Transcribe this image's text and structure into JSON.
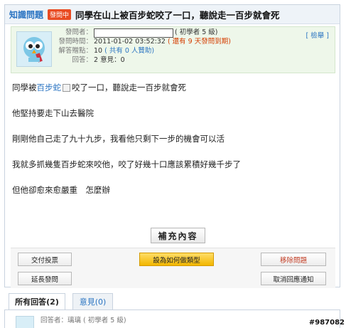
{
  "header": {
    "tagline": "知識問題",
    "status": "發問中",
    "title": "同學在山上被百步蛇咬了一口，聽說走一百步就會死"
  },
  "info": {
    "asker_label": "發問者：",
    "asker_level": "( 初學者 5 級)",
    "time_label": "發問時間：",
    "time_value": "2011-01-02 03:52:32",
    "time_remain": "( 還有 9 天發問到期)",
    "points_label": "解答贈點：",
    "points_value": "10",
    "points_extra": "( 共有 0 人贊助)",
    "answers_label": "回答：",
    "answers_value": "2 意見：0",
    "report": "[ 檢舉 ]"
  },
  "body": {
    "p1_pre": "同學被",
    "p1_link": "百步蛇",
    "p1_post": "咬了一口，聽說走一百步就會死",
    "p2": "他堅持要走下山去醫院",
    "p3": "剛剛他自己走了九十九步，我看他只剩下一步的機會可以活",
    "p4": "我就多抓幾隻百步蛇來咬他，咬了好幾十口應該累積好幾千步了",
    "p5": "但他卻愈來愈嚴重　怎麼辦"
  },
  "supplement": "補充內容",
  "actions": {
    "vote": "交付投票",
    "set_type": "設為如何做類型",
    "remove": "移除問題",
    "extend": "延長發問",
    "cancel_notify": "取消回應通知"
  },
  "tabs": {
    "all": "所有回答(2)",
    "opinions": "意見(0)"
  },
  "answer": {
    "text": "回答者：璃璃 ( 初學者 5 級)"
  },
  "watermark": "#987082"
}
